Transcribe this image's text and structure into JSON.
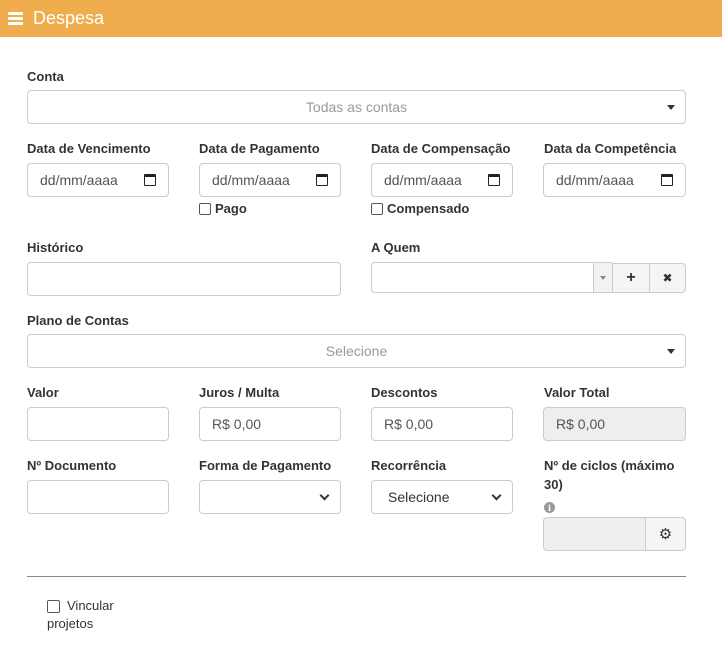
{
  "header": {
    "title": "Despesa",
    "menu_icon": "hamburger-icon",
    "color": "#f0ad4e"
  },
  "conta": {
    "label": "Conta",
    "value": "Todas as contas"
  },
  "datas": {
    "vencimento": {
      "label": "Data de Vencimento",
      "value": "dd/mm/aaaa"
    },
    "pagamento": {
      "label": "Data de Pagamento",
      "value": "dd/mm/aaaa",
      "check_label": "Pago"
    },
    "compensacao": {
      "label": "Data de Compensação",
      "value": "dd/mm/aaaa",
      "check_label": "Compensado"
    },
    "competencia": {
      "label": "Data da Competência",
      "value": "dd/mm/aaaa"
    }
  },
  "historico": {
    "label": "Histórico",
    "value": ""
  },
  "a_quem": {
    "label": "A Quem",
    "value": "",
    "add_label": "+",
    "clear_label": "✖"
  },
  "plano_contas": {
    "label": "Plano de Contas",
    "value": "Selecione"
  },
  "valores": {
    "valor": {
      "label": "Valor",
      "value": ""
    },
    "juros": {
      "label": "Juros / Multa",
      "value": "R$ 0,00"
    },
    "descontos": {
      "label": "Descontos",
      "value": "R$ 0,00"
    },
    "total": {
      "label": "Valor Total",
      "value": "R$ 0,00"
    }
  },
  "documento": {
    "label": "Nº Documento",
    "value": ""
  },
  "forma_pagamento": {
    "label": "Forma de Pagamento",
    "value": ""
  },
  "recorrencia": {
    "label": "Recorrência",
    "value": "Selecione"
  },
  "ciclos": {
    "label_line1": "Nº de ciclos (máximo",
    "label_line2": "30)",
    "info_glyph": "i",
    "value": "",
    "gear_glyph": "⚙"
  },
  "vincular": {
    "line1": "Vincular",
    "line2": "projetos"
  }
}
